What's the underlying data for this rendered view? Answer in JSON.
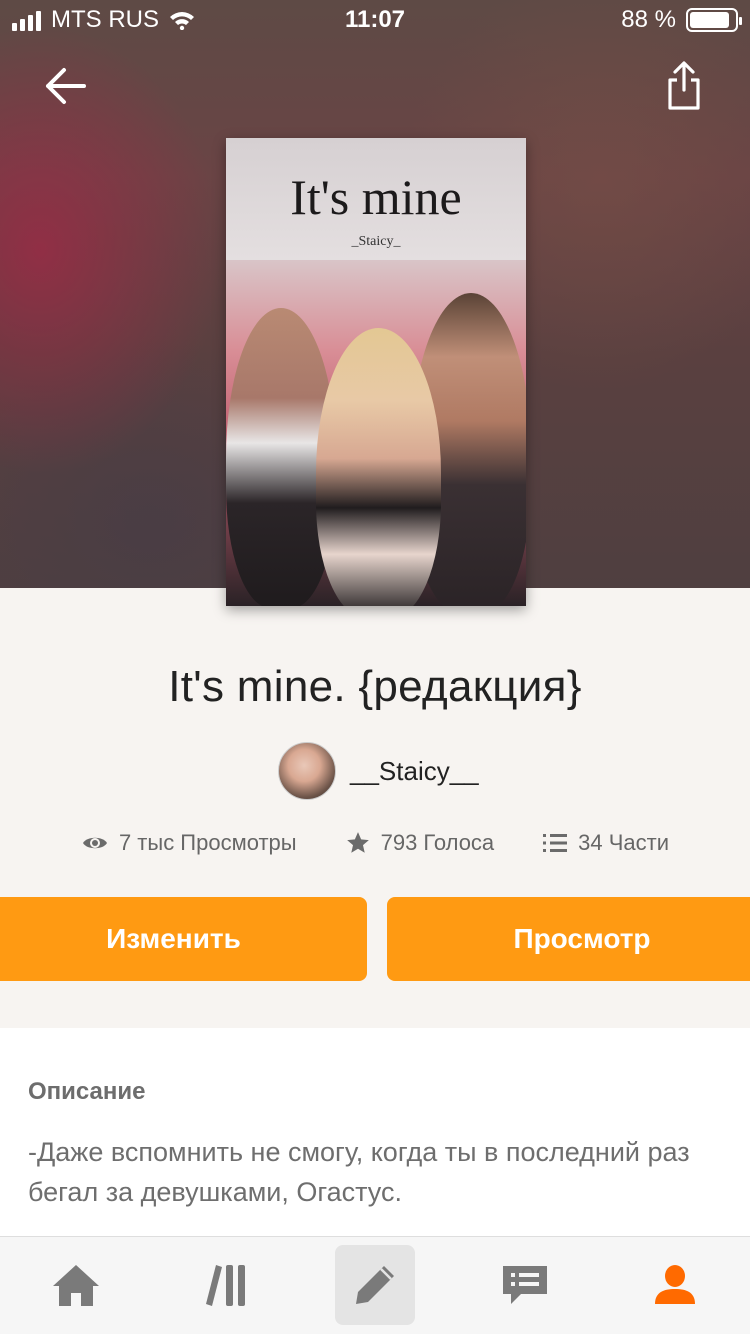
{
  "status_bar": {
    "carrier": "MTS RUS",
    "time": "11:07",
    "battery_text": "88 %",
    "battery_level": 0.88
  },
  "cover": {
    "title": "It's mine",
    "author": "_Staicy_"
  },
  "story": {
    "title": "It's mine. {редакция}",
    "author": "__Staicy__"
  },
  "stats": {
    "views": "7 тыс Просмотры",
    "votes": "793 Голоса",
    "parts": "34 Части"
  },
  "actions": {
    "edit_label": "Изменить",
    "preview_label": "Просмотр"
  },
  "description": {
    "heading": "Описание",
    "text": "-Даже вспомнить не смогу, когда ты в последний раз бегал за девушками, Огастус."
  },
  "tab_bar": {
    "items": [
      "home-icon",
      "library-icon",
      "write-icon",
      "messages-icon",
      "profile-icon"
    ],
    "active": "write-icon"
  },
  "colors": {
    "accent": "#ff9a12",
    "active_profile": "#ff6a00",
    "tab_icon": "#7a7a7a"
  }
}
